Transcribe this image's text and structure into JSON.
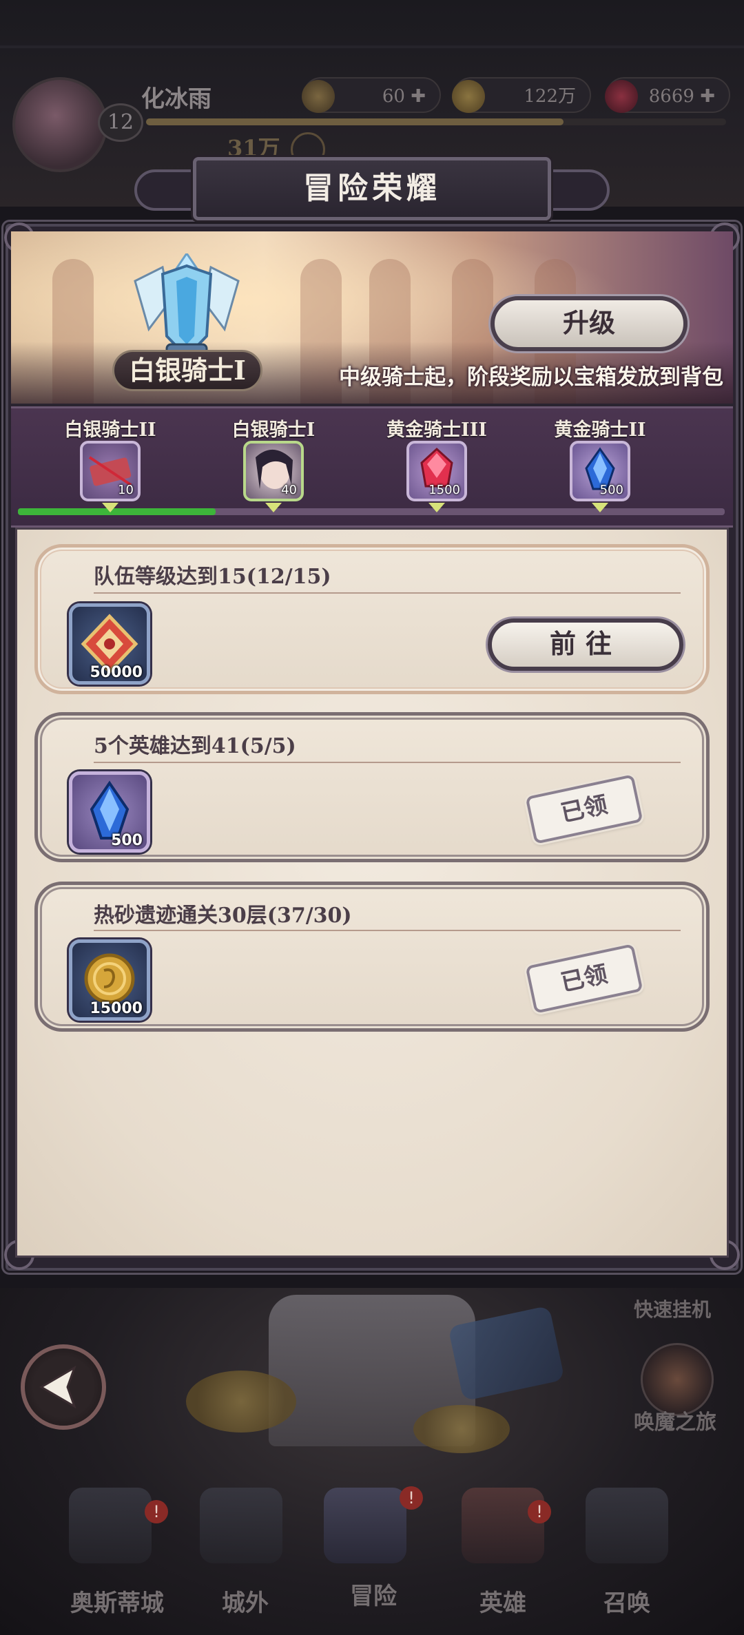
{
  "hud": {
    "player_name": "化冰雨",
    "player_level": "12",
    "power": "31万",
    "stamina": "60",
    "gold": "122万",
    "gems": "8669",
    "exp_fraction": 0.72
  },
  "modal": {
    "title": "冒险荣耀",
    "current_rank": "白银骑士I",
    "upgrade_label": "升级",
    "banner_note": "中级骑士起，阶段奖励以宝箱发放到背包",
    "track_progress_fraction": 0.28,
    "tiers": [
      {
        "label": "白银骑士II",
        "qty": "10",
        "icon": "ticket-icon"
      },
      {
        "label": "白银骑士I",
        "qty": "40",
        "icon": "hero-portrait-icon"
      },
      {
        "label": "黄金骑士III",
        "qty": "1500",
        "icon": "red-gem-icon"
      },
      {
        "label": "黄金骑士II",
        "qty": "500",
        "icon": "blue-crystal-icon"
      }
    ],
    "tasks": [
      {
        "title": "队伍等级达到15(12/15)",
        "reward_qty": "50000",
        "reward_icon": "exp-scroll-icon",
        "action": "前往",
        "state": "in-progress"
      },
      {
        "title": "5个英雄达到41(5/5)",
        "reward_qty": "500",
        "reward_icon": "blue-crystal-icon",
        "action": "已领",
        "state": "claimed"
      },
      {
        "title": "热砂遗迹通关30层(37/30)",
        "reward_qty": "15000",
        "reward_icon": "gold-coin-icon",
        "action": "已领",
        "state": "claimed"
      }
    ]
  },
  "side": {
    "quick_idle": "快速挂机",
    "summon_journey": "唤魔之旅"
  },
  "bottom_nav": [
    {
      "label": "奥斯蒂城",
      "badge": "!"
    },
    {
      "label": "城外",
      "badge": ""
    },
    {
      "label": "冒险",
      "badge": "!"
    },
    {
      "label": "英雄",
      "badge": "!"
    },
    {
      "label": "召唤",
      "badge": ""
    }
  ],
  "colors": {
    "progress_green": "#3db53a",
    "badge_red": "#8a2a26",
    "parchment": "#efe6d9"
  }
}
